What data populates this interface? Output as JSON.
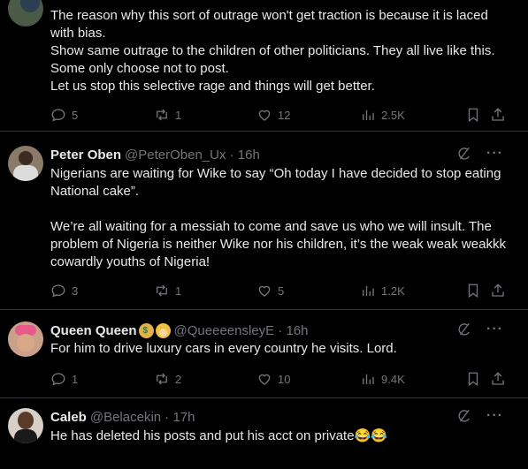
{
  "tweets": [
    {
      "body": [
        "The reason why this sort of outrage won't get traction is because it is laced with bias.",
        "Show same outrage to the children of other politicians. They all live like this. Some only choose not to post.",
        "Let us stop this selective rage and things will get better."
      ],
      "replies": "5",
      "retweets": "1",
      "likes": "12",
      "views": "2.5K"
    },
    {
      "name": "Peter Oben",
      "handle": "@PeterOben_Ux · 16h",
      "body": [
        "Nigerians are waiting for Wike to say “Oh today I have decided to stop eating National cake”.",
        "We’re all waiting for a messiah to come and save us who we will insult. The problem of Nigeria is neither Wike nor his children, it’s the weak weak weakkk cowardly youths of Nigeria!"
      ],
      "replies": "3",
      "retweets": "1",
      "likes": "5",
      "views": "1.2K"
    },
    {
      "name": "Queen Queen",
      "handle": "@QueeeensleyE · 16h",
      "emojis": [
        "money-bag-emoji",
        "princess-emoji"
      ],
      "body": [
        "For him to drive luxury cars in every country he visits. Lord."
      ],
      "replies": "1",
      "retweets": "2",
      "likes": "10",
      "views": "9.4K"
    },
    {
      "name": "Caleb",
      "handle": "@Belacekin · 17h",
      "body": [
        "He has deleted his posts and put his acct on private😂😂"
      ]
    }
  ],
  "colors": {
    "background": "#000000",
    "text": "#e7e9ea",
    "muted": "#71767b",
    "divider": "#2f3336"
  }
}
